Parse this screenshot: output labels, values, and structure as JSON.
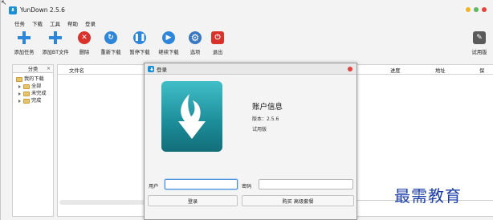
{
  "app": {
    "title": "YunDown 2.5.6"
  },
  "menu": [
    "任务",
    "下载",
    "工具",
    "帮助",
    "登录"
  ],
  "toolbar": [
    {
      "label": "添加任务",
      "icon": "plus-icon"
    },
    {
      "label": "添加BT文件",
      "icon": "plus-icon"
    },
    {
      "label": "删除",
      "icon": "delete-icon"
    },
    {
      "label": "重新下载",
      "icon": "redownload-icon"
    },
    {
      "label": "暂停下载",
      "icon": "pause-icon"
    },
    {
      "label": "继续下载",
      "icon": "play-icon"
    },
    {
      "label": "选项",
      "icon": "gear-icon"
    },
    {
      "label": "退出",
      "icon": "power-icon"
    },
    {
      "label": "试用版",
      "icon": "trial-icon"
    }
  ],
  "sidebar": {
    "header": "分类",
    "close": "×",
    "root": "我的下载",
    "items": [
      "全部",
      "未完成",
      "完成"
    ]
  },
  "list": {
    "columns": [
      "文件名",
      "进度",
      "地址",
      "保"
    ]
  },
  "dialog": {
    "title": "登录",
    "info_title": "账户信息",
    "version": "版本：2.5.6",
    "edition": "试用版",
    "user_label": "用户",
    "user_value": "",
    "password_label": "密码",
    "password_value": "",
    "login_button": "登录",
    "buy_button": "购买 高级套餐"
  },
  "watermark": "最需教育",
  "colors": {
    "accent": "#2d86d9",
    "delete": "#d9322b",
    "logo": "#1b8c98",
    "watermark": "#1e3fa8"
  }
}
